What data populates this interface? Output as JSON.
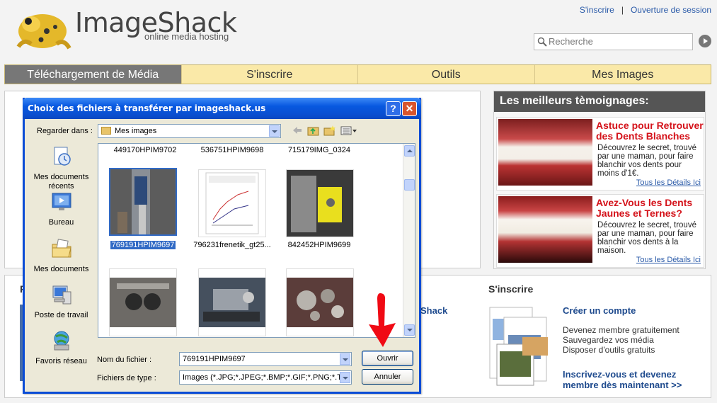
{
  "header": {
    "brand": "ImageShack",
    "tagline": "online media hosting",
    "links": {
      "signup": "S'inscrire",
      "sep": "|",
      "login": "Ouverture de session"
    },
    "search_placeholder": "Recherche"
  },
  "nav": {
    "tabs": [
      {
        "label": "Téléchargement de Média",
        "active": true
      },
      {
        "label": "S'inscrire"
      },
      {
        "label": "Outils"
      },
      {
        "label": "Mes Images"
      }
    ]
  },
  "testimonials": {
    "heading": "Les meilleurs tèmoignages:",
    "ads": [
      {
        "title": "Astuce pour Retrouver des Dents Blanches",
        "desc": "Découvrez le secret, trouvé par une maman, pour faire blanchir vos dents pour moins d'1€.",
        "more": "Tous les Détails Ici"
      },
      {
        "title": "Avez-Vous les Dents Jaunes et Ternes?",
        "desc": "Découvrez le secret, trouvé par une maman, pour faire blanchir vos dents à la maison.",
        "more": "Tous les Détails Ici"
      }
    ]
  },
  "signup_panel": {
    "heading": "S'inscrire",
    "create": "Créer un compte",
    "benefits": [
      "Devenez membre gratuitement",
      "Sauvegardez vos média",
      "Disposer d'outils gratuits"
    ],
    "cta": "Inscrivez-vous et devenez membre dès maintenant >>",
    "shack_fragment": "Shack",
    "left_fragment": "F"
  },
  "dialog": {
    "title": "Choix des fichiers à transférer par imageshack.us",
    "help": "?",
    "close": "✕",
    "look_in_label": "Regarder dans :",
    "look_in_value": "Mes images",
    "places": [
      "Mes documents récents",
      "Bureau",
      "Mes documents",
      "Poste de travail",
      "Favoris réseau"
    ],
    "top_files": [
      "449170HPIM9702",
      "536751HPIM9698",
      "715179IMG_0324"
    ],
    "row2_files": [
      "769191HPIM9697",
      "796231frenetik_gt25...",
      "842452HPIM9699"
    ],
    "filename_label": "Nom du fichier :",
    "filename_value": "769191HPIM9697",
    "filetype_label": "Fichiers de type :",
    "filetype_value": "Images (*.JPG;*.JPEG;*.BMP;*.GIF;*.PNG;*.TIF",
    "open": "Ouvrir",
    "cancel": "Annuler"
  }
}
